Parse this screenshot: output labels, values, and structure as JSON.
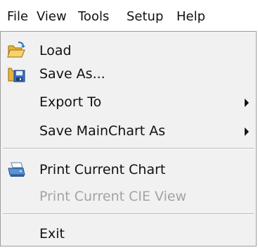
{
  "menubar": {
    "items": [
      {
        "label": "File"
      },
      {
        "label": "View"
      },
      {
        "label": "Tools"
      },
      {
        "label": "Setup"
      },
      {
        "label": "Help"
      }
    ]
  },
  "file_menu": {
    "items": [
      {
        "label": "Load",
        "icon": "folder-open-icon",
        "enabled": true
      },
      {
        "label": "Save As...",
        "icon": "save-icon",
        "enabled": true
      },
      {
        "label": "Export To",
        "submenu": true,
        "enabled": true
      },
      {
        "label": "Save MainChart As",
        "submenu": true,
        "enabled": true
      },
      {
        "label": "Print Current Chart",
        "icon": "printer-icon",
        "enabled": true
      },
      {
        "label": "Print Current CIE View",
        "enabled": false
      },
      {
        "label": "Exit",
        "enabled": true
      }
    ]
  },
  "colors": {
    "menu_background": "#f1f1f1",
    "text": "#111111",
    "disabled_text": "#a3a3a3",
    "separator": "#b9b9b9"
  }
}
